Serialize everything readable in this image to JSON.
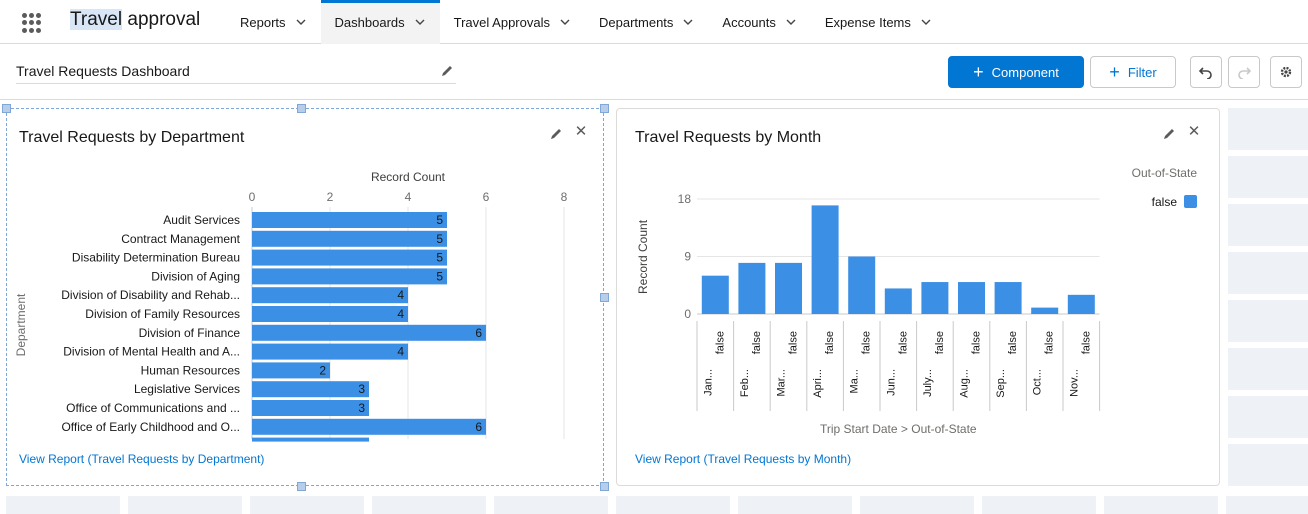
{
  "nav": {
    "app_name_highlight": "Travel",
    "app_name_rest": " approval",
    "tabs": [
      {
        "label": "Reports",
        "active": false
      },
      {
        "label": "Dashboards",
        "active": true
      },
      {
        "label": "Travel Approvals",
        "active": false
      },
      {
        "label": "Departments",
        "active": false
      },
      {
        "label": "Accounts",
        "active": false
      },
      {
        "label": "Expense Items",
        "active": false
      }
    ]
  },
  "toolbar": {
    "dashboard_title": "Travel Requests Dashboard",
    "component_label": "Component",
    "filter_label": "Filter"
  },
  "colors": {
    "accent": "#0176d3",
    "bar": "#3b8fe4",
    "grid_cell": "#eef1f6"
  },
  "widgets": [
    {
      "title": "Travel Requests by Department",
      "link": "View Report (Travel Requests by Department)"
    },
    {
      "title": "Travel Requests by Month",
      "link": "View Report (Travel Requests by Month)"
    }
  ],
  "chart_data": [
    {
      "type": "bar",
      "orientation": "horizontal",
      "title": "Travel Requests by Department",
      "xlabel": "Record Count",
      "ylabel": "Department",
      "xlim": [
        0,
        8
      ],
      "xticks": [
        0,
        2,
        4,
        6,
        8
      ],
      "categories": [
        "Audit Services",
        "Contract Management",
        "Disability Determination Bureau",
        "Division of Aging",
        "Division of Disability and Rehab...",
        "Division of Family Resources",
        "Division of Finance",
        "Division of Mental Health and A...",
        "Human Resources",
        "Legislative Services",
        "Office of Communications and ...",
        "Office of Early Childhood and O..."
      ],
      "values": [
        5,
        5,
        5,
        5,
        4,
        4,
        6,
        4,
        2,
        3,
        3,
        6
      ],
      "data_labels": true,
      "grid": true
    },
    {
      "type": "bar",
      "title": "Travel Requests by Month",
      "xlabel": "Trip Start Date  >  Out-of-State",
      "ylabel": "Record Count",
      "ylim": [
        0,
        18
      ],
      "yticks": [
        0,
        9,
        18
      ],
      "categories": [
        "Jan...",
        "Feb...",
        "Mar...",
        "Apri...",
        "Ma...",
        "Jun...",
        "July...",
        "Aug...",
        "Sep...",
        "Oct...",
        "Nov..."
      ],
      "sub_categories": [
        "false",
        "false",
        "false",
        "false",
        "false",
        "false",
        "false",
        "false",
        "false",
        "false",
        "false"
      ],
      "values": [
        6,
        8,
        8,
        17,
        9,
        4,
        5,
        5,
        5,
        1,
        3
      ],
      "legend": {
        "title": "Out-of-State",
        "entries": [
          "false"
        ],
        "position": "top-right"
      },
      "grid": true
    }
  ]
}
